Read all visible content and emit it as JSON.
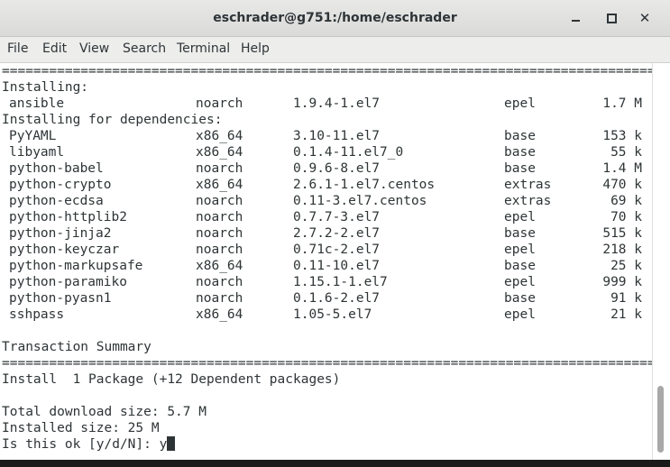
{
  "window": {
    "title": "eschrader@g751:/home/eschrader",
    "minimize_icon": "minimize-icon",
    "maximize_icon": "maximize-icon",
    "close_icon": "close-icon",
    "close_glyph": "✕"
  },
  "menu": [
    "File",
    "Edit",
    "View",
    "Search",
    "Terminal",
    "Help"
  ],
  "terminal": {
    "separator": "==============================================================================================================",
    "installing_header": "Installing:",
    "deps_header": "Installing for dependencies:",
    "packages": [
      {
        "name": "ansible",
        "arch": "noarch",
        "version": "1.9.4-1.el7",
        "repo": "epel",
        "size": "1.7 M"
      }
    ],
    "dependencies": [
      {
        "name": "PyYAML",
        "arch": "x86_64",
        "version": "3.10-11.el7",
        "repo": "base",
        "size": "153 k"
      },
      {
        "name": "libyaml",
        "arch": "x86_64",
        "version": "0.1.4-11.el7_0",
        "repo": "base",
        "size": "55 k"
      },
      {
        "name": "python-babel",
        "arch": "noarch",
        "version": "0.9.6-8.el7",
        "repo": "base",
        "size": "1.4 M"
      },
      {
        "name": "python-crypto",
        "arch": "x86_64",
        "version": "2.6.1-1.el7.centos",
        "repo": "extras",
        "size": "470 k"
      },
      {
        "name": "python-ecdsa",
        "arch": "noarch",
        "version": "0.11-3.el7.centos",
        "repo": "extras",
        "size": "69 k"
      },
      {
        "name": "python-httplib2",
        "arch": "noarch",
        "version": "0.7.7-3.el7",
        "repo": "epel",
        "size": "70 k"
      },
      {
        "name": "python-jinja2",
        "arch": "noarch",
        "version": "2.7.2-2.el7",
        "repo": "base",
        "size": "515 k"
      },
      {
        "name": "python-keyczar",
        "arch": "noarch",
        "version": "0.71c-2.el7",
        "repo": "epel",
        "size": "218 k"
      },
      {
        "name": "python-markupsafe",
        "arch": "x86_64",
        "version": "0.11-10.el7",
        "repo": "base",
        "size": "25 k"
      },
      {
        "name": "python-paramiko",
        "arch": "noarch",
        "version": "1.15.1-1.el7",
        "repo": "epel",
        "size": "999 k"
      },
      {
        "name": "python-pyasn1",
        "arch": "noarch",
        "version": "0.1.6-2.el7",
        "repo": "base",
        "size": "91 k"
      },
      {
        "name": "sshpass",
        "arch": "x86_64",
        "version": "1.05-5.el7",
        "repo": "epel",
        "size": "21 k"
      }
    ],
    "summary_header": "Transaction Summary",
    "install_line": "Install  1 Package (+12 Dependent packages)",
    "download_size": "Total download size: 5.7 M",
    "installed_size": "Installed size: 25 M",
    "prompt": "Is this ok [y/d/N]: ",
    "input": "y"
  }
}
